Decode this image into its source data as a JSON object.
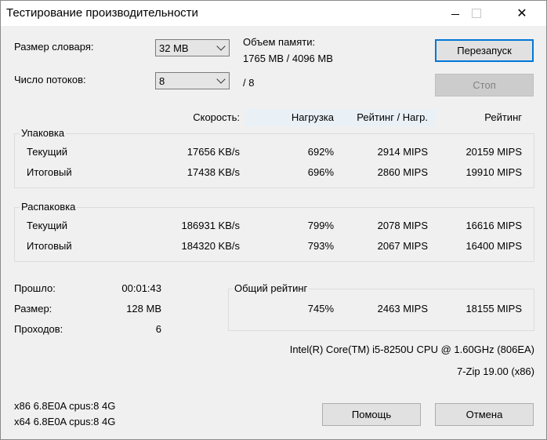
{
  "window": {
    "title": "Тестирование производительности",
    "controls": {
      "minimize": "—",
      "maximize": "☐",
      "close": "✕"
    }
  },
  "settings": {
    "dict_label": "Размер словаря:",
    "dict_value": "32 MB",
    "threads_label": "Число потоков:",
    "threads_value": "8",
    "threads_total": "/ 8",
    "memory_label": "Объем памяти:",
    "memory_value": "1765 MB / 4096 MB"
  },
  "buttons": {
    "restart": "Перезапуск",
    "stop": "Стоп",
    "help": "Помощь",
    "cancel": "Отмена"
  },
  "columns": {
    "speed": "Скорость:",
    "load": "Нагрузка",
    "rating_per_load": "Рейтинг / Нагр.",
    "rating": "Рейтинг"
  },
  "compression": {
    "title": "Упаковка",
    "rows": [
      {
        "label": "Текущий",
        "speed": "17656 KB/s",
        "load": "692%",
        "rpl": "2914 MIPS",
        "rating": "20159 MIPS"
      },
      {
        "label": "Итоговый",
        "speed": "17438 KB/s",
        "load": "696%",
        "rpl": "2860 MIPS",
        "rating": "19910 MIPS"
      }
    ]
  },
  "decompression": {
    "title": "Распаковка",
    "rows": [
      {
        "label": "Текущий",
        "speed": "186931 KB/s",
        "load": "799%",
        "rpl": "2078 MIPS",
        "rating": "16616 MIPS"
      },
      {
        "label": "Итоговый",
        "speed": "184320 KB/s",
        "load": "793%",
        "rpl": "2067 MIPS",
        "rating": "16400 MIPS"
      }
    ]
  },
  "stats": {
    "elapsed_label": "Прошло:",
    "elapsed_value": "00:01:43",
    "size_label": "Размер:",
    "size_value": "128 MB",
    "passes_label": "Проходов:",
    "passes_value": "6"
  },
  "total": {
    "title": "Общий рейтинг",
    "load": "745%",
    "rpl": "2463 MIPS",
    "rating": "18155 MIPS"
  },
  "system": {
    "cpu": "Intel(R) Core(TM) i5-8250U CPU @ 1.60GHz (806EA)",
    "version": "7-Zip 19.00 (x86)",
    "line1": "x86 6.8E0A cpus:8 4G",
    "line2": "x64 6.8E0A cpus:8 4G"
  }
}
